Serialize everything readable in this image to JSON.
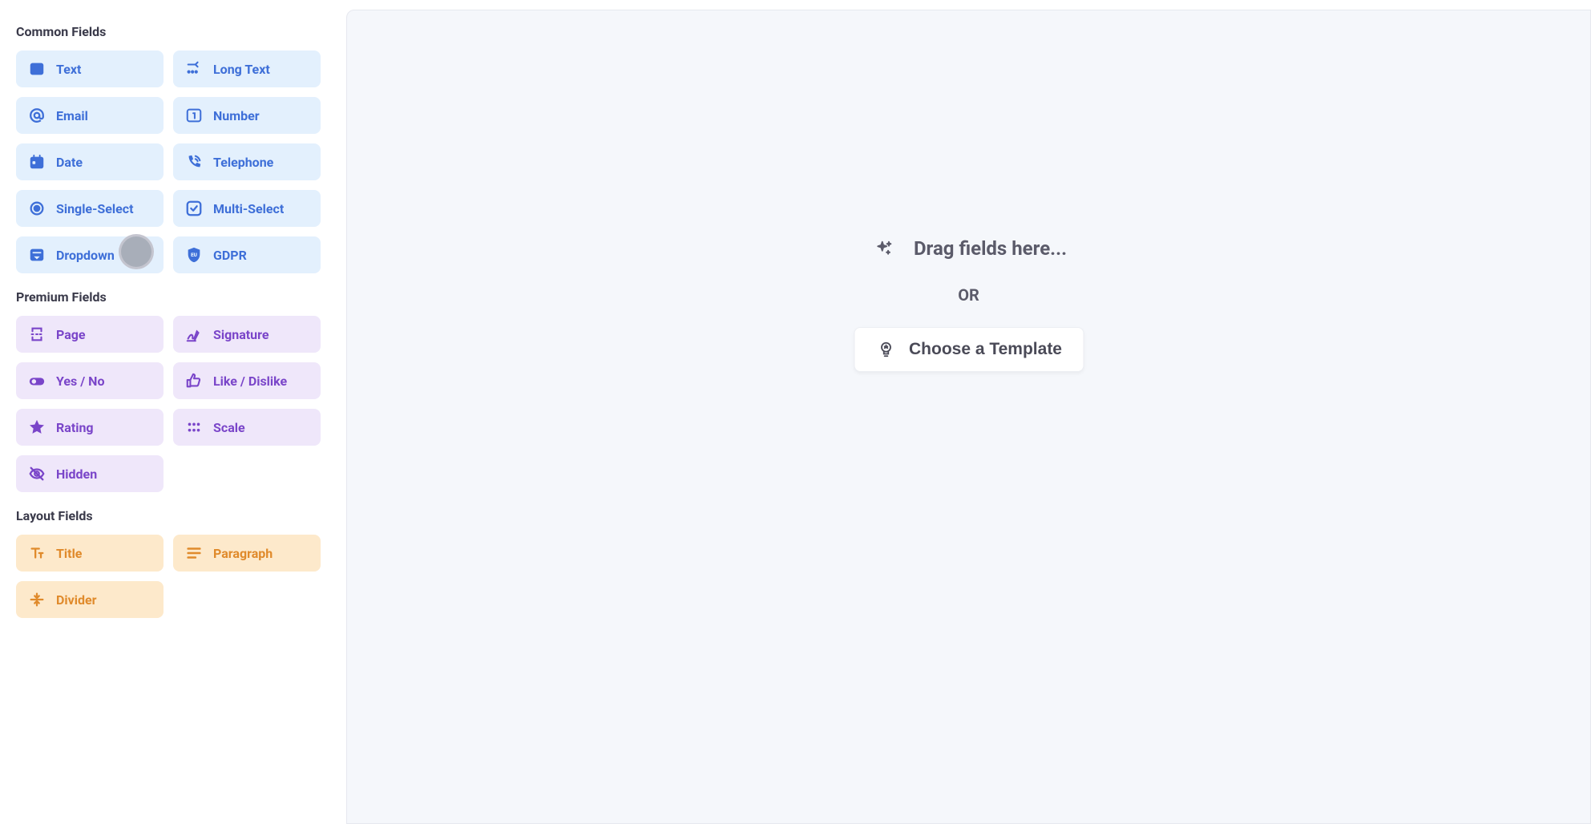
{
  "sidebar": {
    "sections": {
      "common": {
        "title": "Common Fields",
        "items": [
          {
            "label": "Text",
            "icon": "text-a"
          },
          {
            "label": "Long Text",
            "icon": "long-text"
          },
          {
            "label": "Email",
            "icon": "at"
          },
          {
            "label": "Number",
            "icon": "number-one"
          },
          {
            "label": "Date",
            "icon": "calendar"
          },
          {
            "label": "Telephone",
            "icon": "phone"
          },
          {
            "label": "Single-Select",
            "icon": "radio"
          },
          {
            "label": "Multi-Select",
            "icon": "checkbox"
          },
          {
            "label": "Dropdown",
            "icon": "dropdown"
          },
          {
            "label": "GDPR",
            "icon": "shield-eu"
          }
        ]
      },
      "premium": {
        "title": "Premium Fields",
        "items": [
          {
            "label": "Page",
            "icon": "page-break"
          },
          {
            "label": "Signature",
            "icon": "signature"
          },
          {
            "label": "Yes / No",
            "icon": "toggle"
          },
          {
            "label": "Like / Dislike",
            "icon": "thumb"
          },
          {
            "label": "Rating",
            "icon": "star"
          },
          {
            "label": "Scale",
            "icon": "scale"
          },
          {
            "label": "Hidden",
            "icon": "eye-off"
          }
        ]
      },
      "layout": {
        "title": "Layout Fields",
        "items": [
          {
            "label": "Title",
            "icon": "title-t"
          },
          {
            "label": "Paragraph",
            "icon": "paragraph"
          },
          {
            "label": "Divider",
            "icon": "divider"
          }
        ]
      }
    }
  },
  "canvas": {
    "drag_hint": "Drag fields here...",
    "or_label": "OR",
    "template_button": "Choose a Template"
  }
}
